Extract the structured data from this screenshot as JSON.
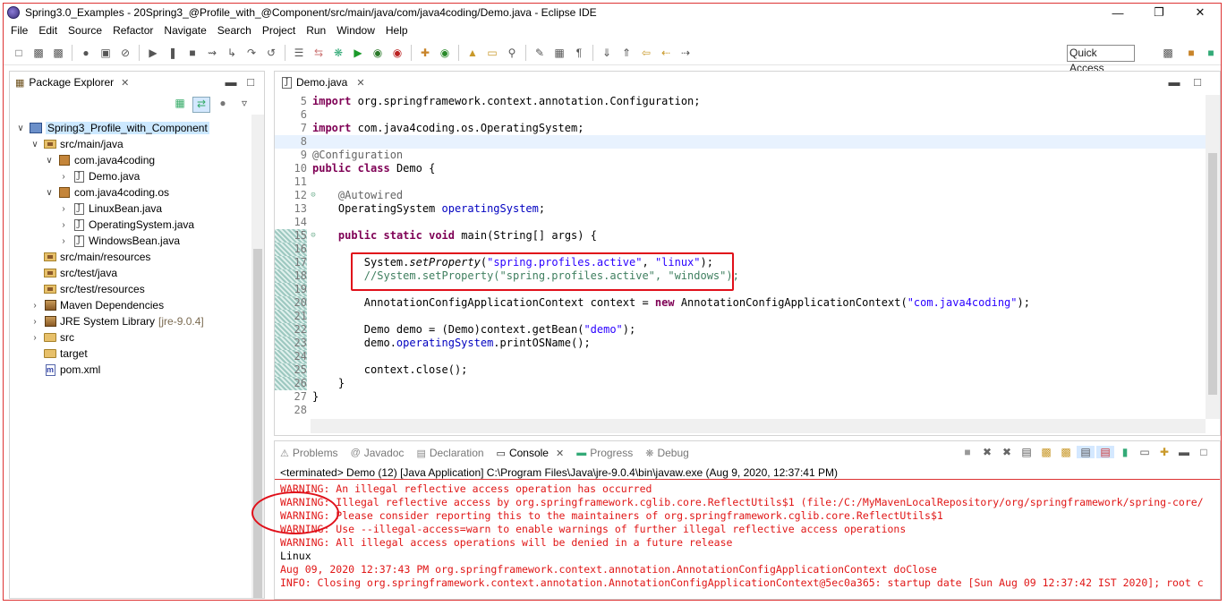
{
  "window": {
    "title": "Spring3.0_Examples - 20Spring3_@Profile_with_@Component/src/main/java/com/java4coding/Demo.java - Eclipse IDE",
    "minimize_glyph": "—",
    "maximize_glyph": "❐",
    "close_glyph": "✕"
  },
  "menu": [
    "File",
    "Edit",
    "Source",
    "Refactor",
    "Navigate",
    "Search",
    "Project",
    "Run",
    "Window",
    "Help"
  ],
  "toolbar": {
    "quick_access": "Quick Access"
  },
  "package_explorer": {
    "tab_label": "Package Explorer",
    "tree": [
      {
        "label": "Spring3_Profile_with_Component",
        "icon": "project-icon",
        "twisty": "v",
        "selected": true
      },
      {
        "label": "src/main/java",
        "icon": "source-folder-icon",
        "twisty": "v"
      },
      {
        "label": "com.java4coding",
        "icon": "package-icon",
        "twisty": "v"
      },
      {
        "label": "Demo.java",
        "icon": "java-file-icon",
        "twisty": ">"
      },
      {
        "label": "com.java4coding.os",
        "icon": "package-icon",
        "twisty": "v"
      },
      {
        "label": "LinuxBean.java",
        "icon": "java-file-icon",
        "twisty": ">"
      },
      {
        "label": "OperatingSystem.java",
        "icon": "java-file-icon",
        "twisty": ">"
      },
      {
        "label": "WindowsBean.java",
        "icon": "java-file-icon",
        "twisty": ">"
      },
      {
        "label": "src/main/resources",
        "icon": "source-folder-icon",
        "twisty": ""
      },
      {
        "label": "src/test/java",
        "icon": "source-folder-icon",
        "twisty": ""
      },
      {
        "label": "src/test/resources",
        "icon": "source-folder-icon",
        "twisty": ""
      },
      {
        "label": "Maven Dependencies",
        "icon": "library-icon",
        "twisty": ">"
      },
      {
        "label": "JRE System Library",
        "extra": "[jre-9.0.4]",
        "icon": "library-icon",
        "twisty": ">"
      },
      {
        "label": "src",
        "icon": "folder-icon",
        "twisty": ">"
      },
      {
        "label": "target",
        "icon": "folder-icon",
        "twisty": ""
      },
      {
        "label": "pom.xml",
        "icon": "pom-file-icon",
        "twisty": ""
      }
    ]
  },
  "editor": {
    "tab_label": "Demo.java",
    "lines": [
      {
        "n": "5",
        "html": "<span class='kw'>import</span> org.springframework.context.annotation.Configuration;"
      },
      {
        "n": "6",
        "html": ""
      },
      {
        "n": "7",
        "html": "<span class='kw'>import</span> com.java4coding.os.OperatingSystem;"
      },
      {
        "n": "8",
        "html": "",
        "hl": true
      },
      {
        "n": "9",
        "html": "<span class='an'>@Configuration</span>"
      },
      {
        "n": "10",
        "html": "<span class='kw'>public</span> <span class='kw'>class</span> Demo {"
      },
      {
        "n": "11",
        "html": ""
      },
      {
        "n": "12",
        "html": "    <span class='an'>@Autowired</span>",
        "fold": true
      },
      {
        "n": "13",
        "html": "    OperatingSystem <span class='fd'>operatingSystem</span>;"
      },
      {
        "n": "14",
        "html": ""
      },
      {
        "n": "15",
        "html": "    <span class='kw'>public</span> <span class='kw'>static</span> <span class='kw'>void</span> main(String[] args) {",
        "fold": true,
        "mark": true
      },
      {
        "n": "16",
        "html": "",
        "mark": true
      },
      {
        "n": "17",
        "html": "        System.<span class='it'>setProperty</span>(<span class='st'>\"spring.profiles.active\"</span>, <span class='st'>\"linux\"</span>);",
        "mark": true
      },
      {
        "n": "18",
        "html": "        <span class='cm'>//System.setProperty(\"spring.profiles.active\", \"windows\");</span>",
        "mark": true
      },
      {
        "n": "19",
        "html": "",
        "mark": true
      },
      {
        "n": "20",
        "html": "        AnnotationConfigApplicationContext context = <span class='kw'>new</span> AnnotationConfigApplicationContext(<span class='st'>\"com.java4coding\"</span>);",
        "mark": true
      },
      {
        "n": "21",
        "html": "",
        "mark": true
      },
      {
        "n": "22",
        "html": "        Demo demo = (Demo)context.getBean(<span class='st'>\"demo\"</span>);",
        "mark": true
      },
      {
        "n": "23",
        "html": "        demo.<span class='fd'>operatingSystem</span>.printOSName();",
        "mark": true
      },
      {
        "n": "24",
        "html": "",
        "mark": true
      },
      {
        "n": "25",
        "html": "        context.close();",
        "mark": true
      },
      {
        "n": "26",
        "html": "    }",
        "mark": true
      },
      {
        "n": "27",
        "html": "}"
      },
      {
        "n": "28",
        "html": ""
      }
    ]
  },
  "console": {
    "tabs": [
      {
        "label": "Problems",
        "icon": "problems-icon",
        "active": false
      },
      {
        "label": "Javadoc",
        "icon": "javadoc-icon",
        "active": false
      },
      {
        "label": "Declaration",
        "icon": "declaration-icon",
        "active": false
      },
      {
        "label": "Console",
        "icon": "console-icon",
        "active": true
      },
      {
        "label": "Progress",
        "icon": "progress-icon",
        "active": false
      },
      {
        "label": "Debug",
        "icon": "debug-icon",
        "active": false
      }
    ],
    "status": "<terminated> Demo (12) [Java Application] C:\\Program Files\\Java\\jre-9.0.4\\bin\\javaw.exe (Aug 9, 2020, 12:37:41 PM)",
    "output": [
      {
        "text": "WARNING: An illegal reflective access operation has occurred",
        "err": true
      },
      {
        "text": "WARNING: Illegal reflective access by org.springframework.cglib.core.ReflectUtils$1 (file:/C:/MyMavenLocalRepository/org/springframework/spring-core/",
        "err": true
      },
      {
        "text": "WARNING: Please consider reporting this to the maintainers of org.springframework.cglib.core.ReflectUtils$1",
        "err": true
      },
      {
        "text": "WARNING: Use --illegal-access=warn to enable warnings of further illegal reflective access operations",
        "err": true
      },
      {
        "text": "WARNING: All illegal access operations will be denied in a future release",
        "err": true
      },
      {
        "text": "Linux",
        "err": false
      },
      {
        "text": "Aug 09, 2020 12:37:43 PM org.springframework.context.annotation.AnnotationConfigApplicationContext doClose",
        "err": true
      },
      {
        "text": "INFO: Closing org.springframework.context.annotation.AnnotationConfigApplicationContext@5ec0a365: startup date [Sun Aug 09 12:37:42 IST 2020]; root c",
        "err": true
      }
    ]
  }
}
